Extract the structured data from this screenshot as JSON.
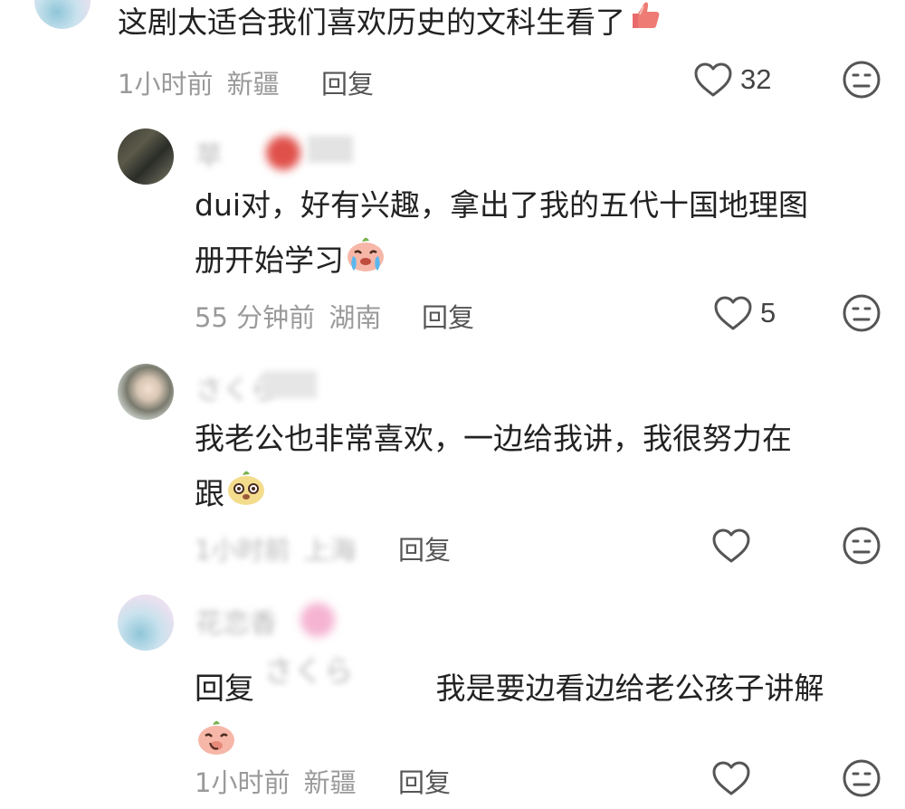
{
  "comments": [
    {
      "text": "这剧太适合我们喜欢历史的文科生看了",
      "time": "1小时前",
      "location": "新疆",
      "reply_label": "回复",
      "likes": "32"
    },
    {
      "username": "苹",
      "text": "dui对，好有兴趣，拿出了我的五代十国地理图册开始学习",
      "line1": "dui对，好有兴趣，拿出了我的五代十国地理图",
      "line2": "册开始学习",
      "time": "55 分钟前",
      "location": "湖南",
      "reply_label": "回复",
      "likes": "5"
    },
    {
      "username": "さくら",
      "text": "我老公也非常喜欢，一边给我讲，我很努力在跟",
      "line1": "我老公也非常喜欢，一边给我讲，我很努力在",
      "line2": "跟",
      "time": "1小时前",
      "location": "上海",
      "reply_label": "回复"
    },
    {
      "username": "花恋香",
      "reply_prefix": "回复",
      "reply_target": "さくら",
      "text": "我是要边看边给老公孩子讲解",
      "time": "1小时前",
      "location": "新疆",
      "reply_label": "回复"
    }
  ]
}
